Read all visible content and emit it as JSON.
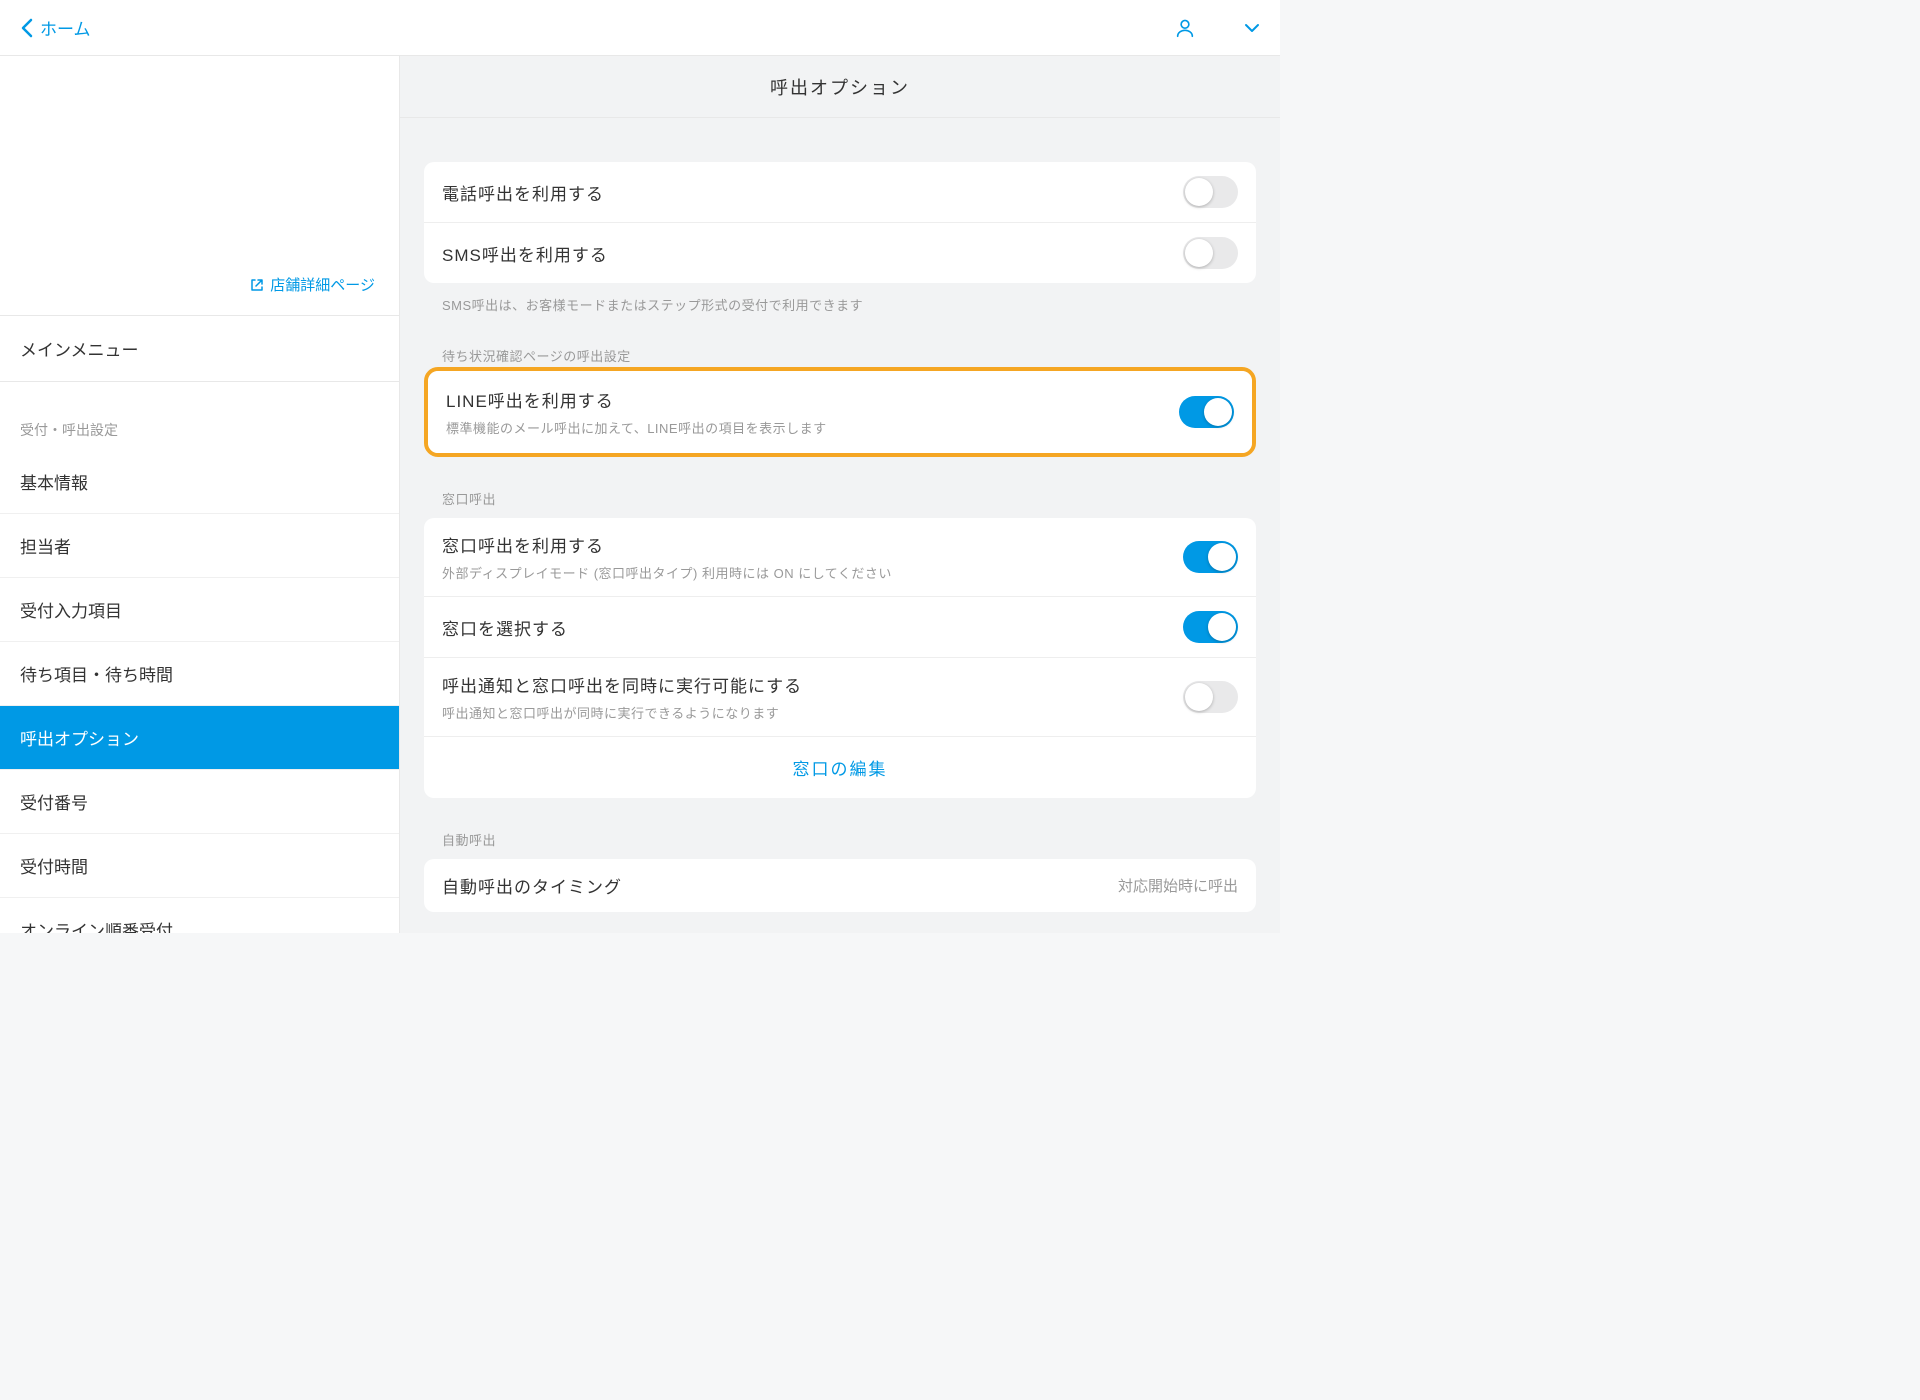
{
  "header": {
    "back_label": "ホーム"
  },
  "sidebar": {
    "store_link": "店舗詳細ページ",
    "main_menu_label": "メインメニュー",
    "section_label": "受付・呼出設定",
    "items": [
      {
        "label": "基本情報",
        "active": false
      },
      {
        "label": "担当者",
        "active": false
      },
      {
        "label": "受付入力項目",
        "active": false
      },
      {
        "label": "待ち項目・待ち時間",
        "active": false
      },
      {
        "label": "呼出オプション",
        "active": true
      },
      {
        "label": "受付番号",
        "active": false
      },
      {
        "label": "受付時間",
        "active": false
      },
      {
        "label": "オンライン順番受付",
        "active": false
      }
    ]
  },
  "main": {
    "title": "呼出オプション",
    "section1": {
      "rows": [
        {
          "title": "電話呼出を利用する",
          "on": false
        },
        {
          "title": "SMS呼出を利用する",
          "on": false
        }
      ],
      "note": "SMS呼出は、お客様モードまたはステップ形式の受付で利用できます"
    },
    "wait_section_label": "待ち状況確認ページの呼出設定",
    "line_row": {
      "title": "LINE呼出を利用する",
      "sub": "標準機能のメール呼出に加えて、LINE呼出の項目を表示します",
      "on": true
    },
    "window_section_label": "窓口呼出",
    "window_rows": [
      {
        "title": "窓口呼出を利用する",
        "sub": "外部ディスプレイモード (窓口呼出タイプ) 利用時には ON にしてください",
        "on": true
      },
      {
        "title": "窓口を選択する",
        "sub": "",
        "on": true
      },
      {
        "title": "呼出通知と窓口呼出を同時に実行可能にする",
        "sub": "呼出通知と窓口呼出が同時に実行できるようになります",
        "on": false
      }
    ],
    "window_edit_link": "窓口の編集",
    "auto_section_label": "自動呼出",
    "auto_row_title": "自動呼出のタイミング",
    "auto_row_value": "対応開始時に呼出"
  }
}
